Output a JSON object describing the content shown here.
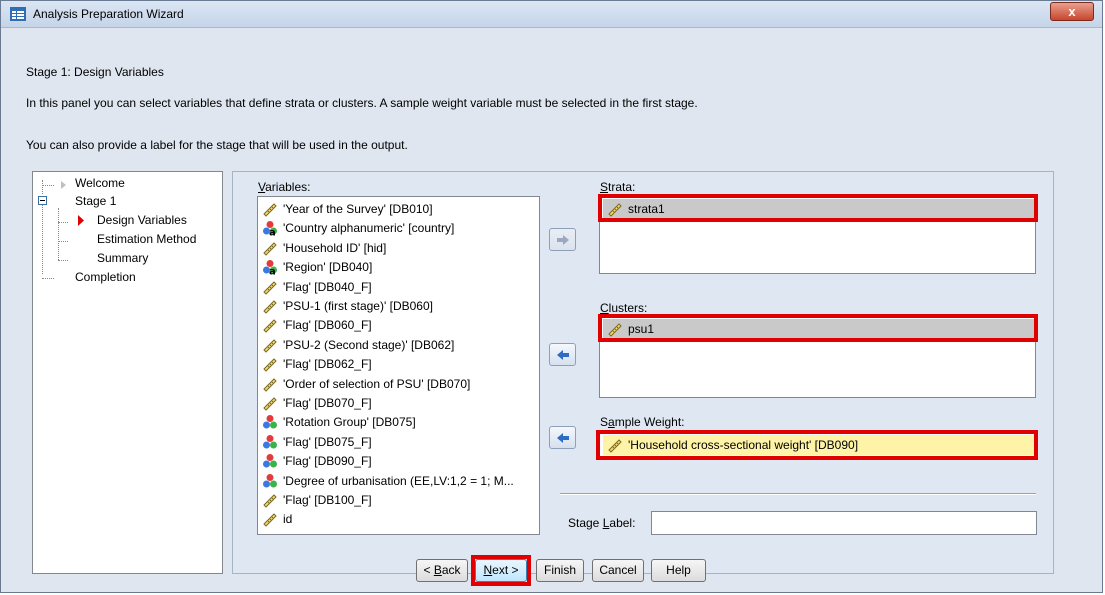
{
  "window": {
    "title": "Analysis Preparation Wizard",
    "close_label": "x"
  },
  "header": {
    "stage_heading": "Stage 1: Design Variables",
    "description1": "In this panel you can select variables that define strata or clusters. A sample weight variable must be selected in the first stage.",
    "description2": "You can also provide a label for the stage that will be used in the output."
  },
  "tree": {
    "welcome": "Welcome",
    "stage1": "Stage 1",
    "design_variables": "Design Variables",
    "estimation_method": "Estimation Method",
    "summary": "Summary",
    "completion": "Completion"
  },
  "variables": {
    "label_prefix": "",
    "label_underlined": "V",
    "label_rest": "ariables:",
    "items": [
      {
        "text": "'Year of the Survey' [DB010]",
        "icon": "ruler-icon"
      },
      {
        "text": "'Country alphanumeric' [country]",
        "icon": "nominal-string-icon"
      },
      {
        "text": "'Household ID' [hid]",
        "icon": "ruler-icon"
      },
      {
        "text": "'Region' [DB040]",
        "icon": "nominal-string-icon"
      },
      {
        "text": "'Flag' [DB040_F]",
        "icon": "ruler-icon"
      },
      {
        "text": "'PSU-1 (first stage)' [DB060]",
        "icon": "ruler-icon"
      },
      {
        "text": "'Flag' [DB060_F]",
        "icon": "ruler-icon"
      },
      {
        "text": "'PSU-2 (Second stage)' [DB062]",
        "icon": "ruler-icon"
      },
      {
        "text": "'Flag' [DB062_F]",
        "icon": "ruler-icon"
      },
      {
        "text": "'Order of selection of PSU' [DB070]",
        "icon": "ruler-icon"
      },
      {
        "text": "'Flag' [DB070_F]",
        "icon": "ruler-icon"
      },
      {
        "text": "'Rotation Group' [DB075]",
        "icon": "nominal-icon"
      },
      {
        "text": "'Flag' [DB075_F]",
        "icon": "nominal-icon"
      },
      {
        "text": "'Flag' [DB090_F]",
        "icon": "nominal-icon"
      },
      {
        "text": "'Degree of urbanisation (EE,LV:1,2 = 1; M...",
        "icon": "nominal-icon"
      },
      {
        "text": "'Flag' [DB100_F]",
        "icon": "ruler-icon"
      },
      {
        "text": "id",
        "icon": "ruler-icon"
      }
    ]
  },
  "strata": {
    "label_underlined": "S",
    "label_rest": "trata:",
    "value": "strata1"
  },
  "clusters": {
    "label_underlined": "C",
    "label_rest": "lusters:",
    "value": "psu1"
  },
  "weight": {
    "label_prefix": "S",
    "label_underlined": "a",
    "label_rest": "mple Weight:",
    "value": "'Household cross-sectional weight' [DB090]"
  },
  "stage_label": {
    "label_prefix": "Stage ",
    "label_underlined": "L",
    "label_rest": "abel:",
    "value": ""
  },
  "buttons": {
    "back_prefix": "< ",
    "back_underlined": "B",
    "back_rest": "ack",
    "next_underlined": "N",
    "next_rest": "ext >",
    "finish": "Finish",
    "cancel": "Cancel",
    "help": "Help"
  },
  "colors": {
    "highlight": "#e00000",
    "selected_row": "#c9c9c9",
    "weight_row": "#fff3a8"
  }
}
